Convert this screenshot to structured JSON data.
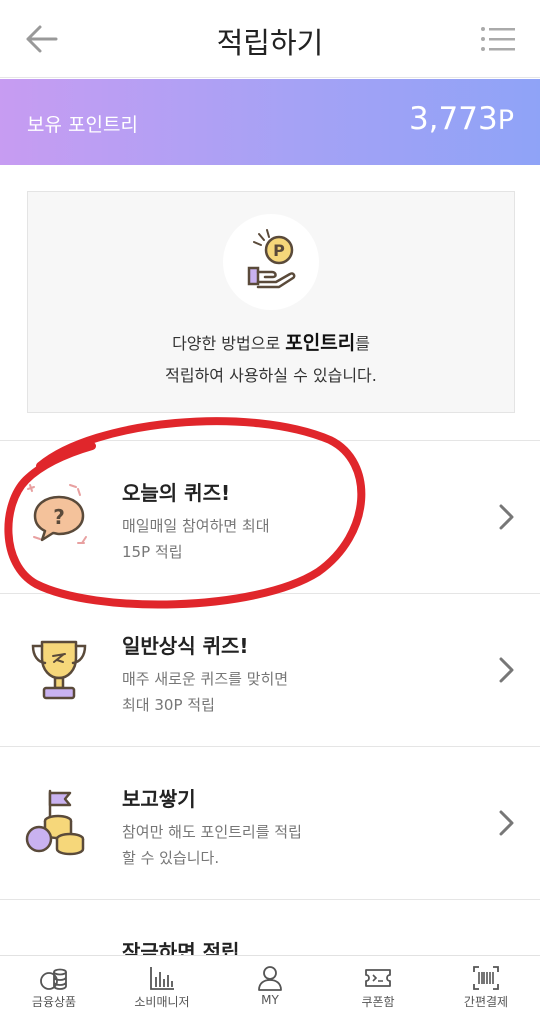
{
  "header": {
    "title": "적립하기",
    "back_icon": "arrow-left-icon",
    "menu_icon": "list-menu-icon"
  },
  "points": {
    "label": "보유 포인트리",
    "amount": "3,773",
    "unit": "P"
  },
  "intro": {
    "icon": "hand-coin-icon",
    "line1_prefix": "다양한 방법으로 ",
    "line1_bold": "포인트리",
    "line1_suffix": "를",
    "line2": "적립하여 사용하실 수 있습니다."
  },
  "rows": [
    {
      "icon": "quiz-speech-bubble-icon",
      "title": "오늘의 퀴즈!",
      "desc1": "매일매일 참여하면 최대",
      "desc2": "15P 적립"
    },
    {
      "icon": "trophy-icon",
      "title": "일반상식 퀴즈!",
      "desc1": "매주 새로운 퀴즈를 맞히면",
      "desc2": "최대 30P 적립"
    },
    {
      "icon": "coins-flag-icon",
      "title": "보고쌓기",
      "desc1": "참여만 해도 포인트리를 적립",
      "desc2": "할 수 있습니다."
    },
    {
      "icon": "card-icon",
      "title": "잠금하면 적립",
      "desc1": "",
      "desc2": ""
    }
  ],
  "tabbar": [
    {
      "label": "금융상품",
      "icon": "coins-stack-icon"
    },
    {
      "label": "소비매니저",
      "icon": "bar-chart-icon"
    },
    {
      "label": "MY",
      "icon": "person-icon"
    },
    {
      "label": "쿠폰함",
      "icon": "coupon-icon"
    },
    {
      "label": "간편결제",
      "icon": "barcode-icon"
    }
  ],
  "colors": {
    "points_gradient_start": "#c79cf2",
    "points_gradient_end": "#8fa3f7",
    "annotation_circle": "#e0262b",
    "icon_yellow": "#f6d77a",
    "icon_purple": "#c9b2f0",
    "icon_outline": "#5a4a3a"
  }
}
